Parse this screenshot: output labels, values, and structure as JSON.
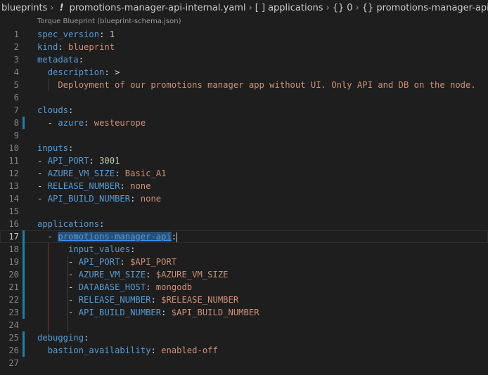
{
  "breadcrumb": {
    "folder": "blueprints",
    "file_icon": "!",
    "file": "promotions-manager-api-internal.yaml",
    "array_icon": "[ ]",
    "section": "applications",
    "obj_icon_1": "{}",
    "index": "0",
    "obj_icon_2": "{}",
    "item": "promotions-manager-api"
  },
  "codelens": "Torque Blueprint (blueprint-schema.json)",
  "lines": [
    {
      "n": "1",
      "segs": [
        [
          "k",
          "spec_version"
        ],
        [
          "p",
          ": "
        ],
        [
          "n",
          "1"
        ]
      ]
    },
    {
      "n": "2",
      "segs": [
        [
          "k",
          "kind"
        ],
        [
          "p",
          ": "
        ],
        [
          "s",
          "blueprint"
        ]
      ]
    },
    {
      "n": "3",
      "segs": [
        [
          "k",
          "metadata"
        ],
        [
          "p",
          ":"
        ]
      ]
    },
    {
      "n": "4",
      "segs": [
        [
          "p",
          "  "
        ],
        [
          "k",
          "description"
        ],
        [
          "p",
          ": >"
        ]
      ]
    },
    {
      "n": "5",
      "segs": [
        [
          "s",
          "    Deployment of our promotions manager app without UI. Only API and DB on the node."
        ]
      ]
    },
    {
      "n": "6",
      "segs": []
    },
    {
      "n": "7",
      "segs": [
        [
          "k",
          "clouds"
        ],
        [
          "p",
          ":"
        ]
      ]
    },
    {
      "n": "8",
      "segs": [
        [
          "p",
          "  - "
        ],
        [
          "k",
          "azure"
        ],
        [
          "p",
          ": "
        ],
        [
          "s",
          "westeurope"
        ]
      ]
    },
    {
      "n": "9",
      "segs": []
    },
    {
      "n": "10",
      "segs": [
        [
          "k",
          "inputs"
        ],
        [
          "p",
          ":"
        ]
      ]
    },
    {
      "n": "11",
      "segs": [
        [
          "p",
          "- "
        ],
        [
          "k",
          "API_PORT"
        ],
        [
          "p",
          ": "
        ],
        [
          "n",
          "3001"
        ]
      ]
    },
    {
      "n": "12",
      "segs": [
        [
          "p",
          "- "
        ],
        [
          "k",
          "AZURE_VM_SIZE"
        ],
        [
          "p",
          ": "
        ],
        [
          "s",
          "Basic_A1"
        ]
      ]
    },
    {
      "n": "13",
      "segs": [
        [
          "p",
          "- "
        ],
        [
          "k",
          "RELEASE_NUMBER"
        ],
        [
          "p",
          ": "
        ],
        [
          "s",
          "none"
        ]
      ]
    },
    {
      "n": "14",
      "segs": [
        [
          "p",
          "- "
        ],
        [
          "k",
          "API_BUILD_NUMBER"
        ],
        [
          "p",
          ": "
        ],
        [
          "s",
          "none"
        ]
      ]
    },
    {
      "n": "15",
      "segs": []
    },
    {
      "n": "16",
      "segs": [
        [
          "k",
          "applications"
        ],
        [
          "p",
          ":"
        ]
      ]
    },
    {
      "n": "17",
      "segs": [
        [
          "p",
          "  - "
        ],
        [
          "k hl",
          "promotions-manager-api"
        ],
        [
          "p",
          ":"
        ]
      ],
      "current": true
    },
    {
      "n": "18",
      "segs": [
        [
          "p",
          "      "
        ],
        [
          "k",
          "input_values"
        ],
        [
          "p",
          ":"
        ]
      ]
    },
    {
      "n": "19",
      "segs": [
        [
          "p",
          "      - "
        ],
        [
          "k",
          "API_PORT"
        ],
        [
          "p",
          ": "
        ],
        [
          "s",
          "$API_PORT"
        ]
      ]
    },
    {
      "n": "20",
      "segs": [
        [
          "p",
          "      - "
        ],
        [
          "k",
          "AZURE_VM_SIZE"
        ],
        [
          "p",
          ": "
        ],
        [
          "s",
          "$AZURE_VM_SIZE"
        ]
      ]
    },
    {
      "n": "21",
      "segs": [
        [
          "p",
          "      - "
        ],
        [
          "k",
          "DATABASE_HOST"
        ],
        [
          "p",
          ": "
        ],
        [
          "s",
          "mongodb"
        ]
      ]
    },
    {
      "n": "22",
      "segs": [
        [
          "p",
          "      - "
        ],
        [
          "k",
          "RELEASE_NUMBER"
        ],
        [
          "p",
          ": "
        ],
        [
          "s",
          "$RELEASE_NUMBER"
        ]
      ]
    },
    {
      "n": "23",
      "segs": [
        [
          "p",
          "      - "
        ],
        [
          "k",
          "API_BUILD_NUMBER"
        ],
        [
          "p",
          ": "
        ],
        [
          "s",
          "$API_BUILD_NUMBER"
        ]
      ]
    },
    {
      "n": "24",
      "segs": []
    },
    {
      "n": "25",
      "segs": [
        [
          "k",
          "debugging"
        ],
        [
          "p",
          ":"
        ]
      ]
    },
    {
      "n": "26",
      "segs": [
        [
          "p",
          "  "
        ],
        [
          "k",
          "bastion_availability"
        ],
        [
          "p",
          ": "
        ],
        [
          "s",
          "enabled-off"
        ]
      ]
    },
    {
      "n": "27",
      "segs": []
    }
  ],
  "colors": {
    "background": "#1e1e1e",
    "key": "#569cd6",
    "string": "#ce9178",
    "number": "#b5cea8",
    "gutter_modified": "#1b81a8",
    "selection": "#264f78"
  }
}
